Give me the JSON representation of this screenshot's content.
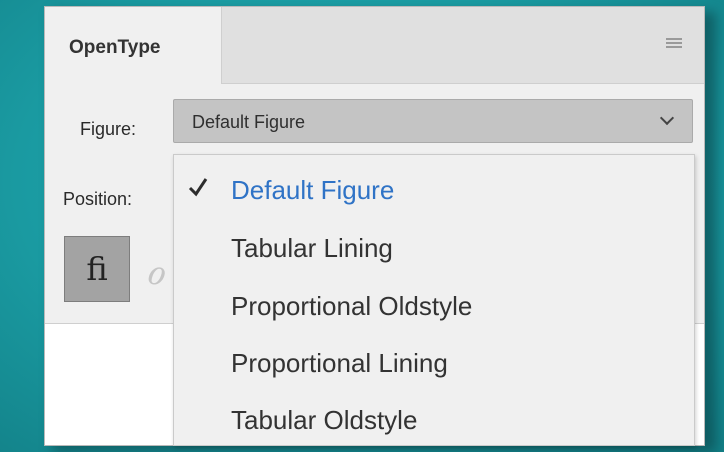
{
  "panel": {
    "tab_title": "OpenType",
    "menu_icon": "hamburger-menu-icon"
  },
  "figure": {
    "label": "Figure:",
    "selected_value": "Default Figure",
    "options": [
      {
        "label": "Default Figure",
        "selected": true
      },
      {
        "label": "Tabular Lining",
        "selected": false
      },
      {
        "label": "Proportional Oldstyle",
        "selected": false
      },
      {
        "label": "Proportional Lining",
        "selected": false
      },
      {
        "label": "Tabular Oldstyle",
        "selected": false
      }
    ]
  },
  "position": {
    "label": "Position:"
  },
  "buttons": {
    "ligature_glyph": "ﬁ",
    "swash_glyph": "ℴ"
  },
  "colors": {
    "selected_option": "#2f73c6",
    "background_teal": "#1a9aa1"
  }
}
